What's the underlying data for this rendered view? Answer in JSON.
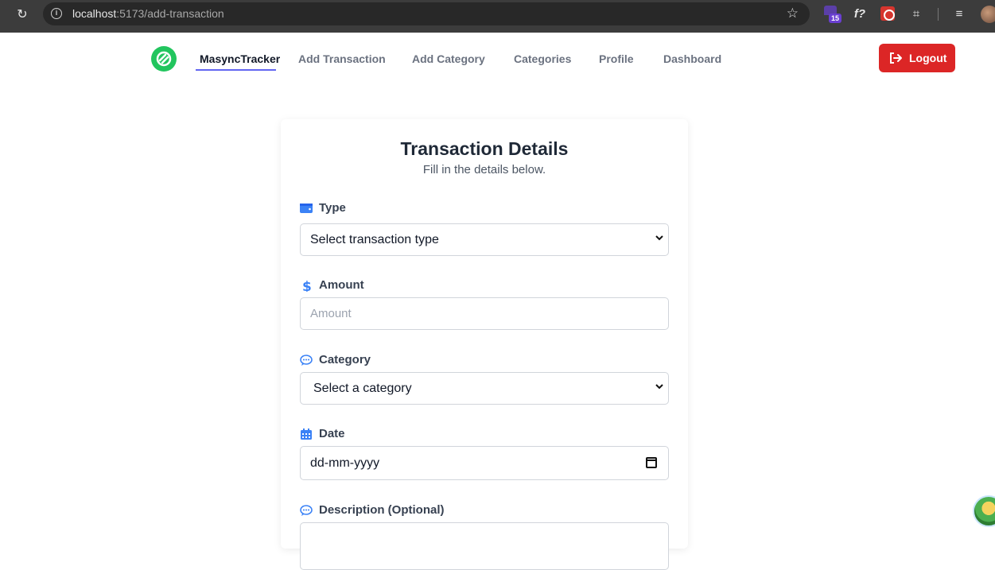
{
  "browser": {
    "url_host": "localhost",
    "url_path": ":5173/add-transaction",
    "extension_badge_count": "15",
    "ext_fx_label": "f?"
  },
  "nav": {
    "brand": "MasyncTracker",
    "links": [
      "Add Transaction",
      "Add Category",
      "Categories",
      "Profile",
      "Dashboard"
    ],
    "logout_label": "Logout",
    "colors": {
      "logo": "#22c55e",
      "active_underline": "#6366f1",
      "logout": "#dc2626"
    }
  },
  "form": {
    "title": "Transaction Details",
    "subtitle": "Fill in the details below.",
    "type_label": "Type",
    "type_value": "Select transaction type",
    "amount_label": "Amount",
    "amount_placeholder": "Amount",
    "category_label": "Category",
    "category_value": "Select a category",
    "date_label": "Date",
    "date_value": "dd-mm-yyyy",
    "description_label": "Description (Optional)",
    "icon_color": "#3b82f6"
  }
}
